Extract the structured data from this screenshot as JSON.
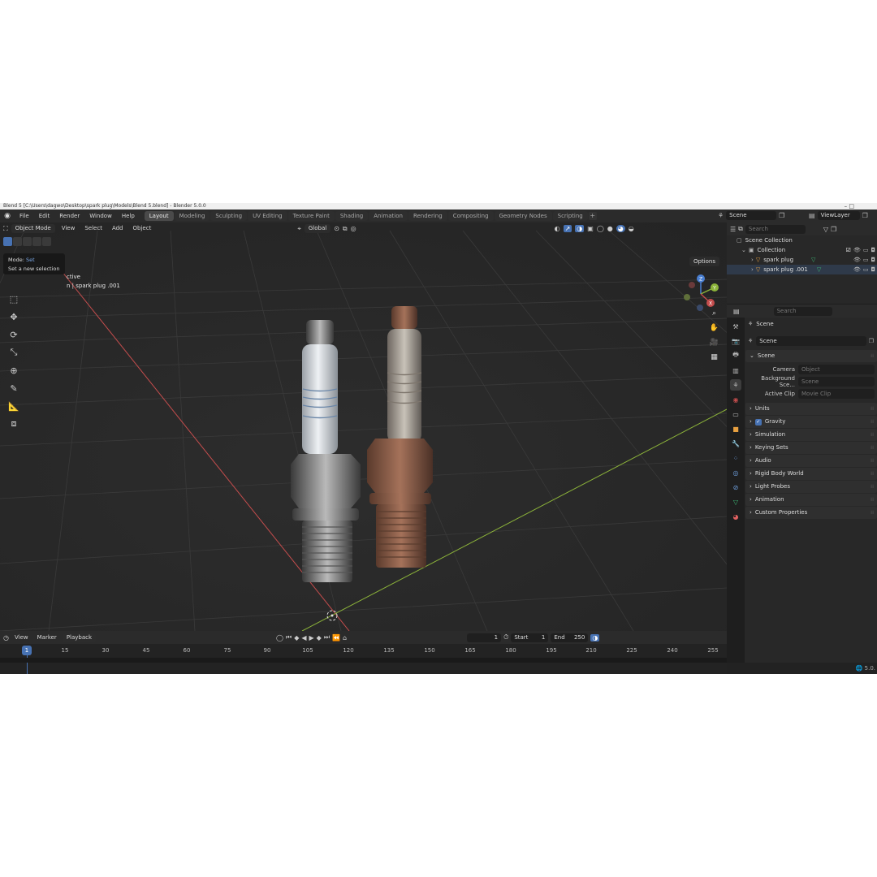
{
  "titlebar": {
    "text": "Blend 5 [C:\\Users\\dagwo\\Desktop\\spark plug\\Models\\Blend 5.blend] - Blender 5.0.0",
    "window_controls": "–  □"
  },
  "menubar": {
    "logo_icon": "blender-logo",
    "items": [
      "File",
      "Edit",
      "Render",
      "Window",
      "Help"
    ],
    "workspaces": [
      "Layout",
      "Modeling",
      "Sculpting",
      "UV Editing",
      "Texture Paint",
      "Shading",
      "Animation",
      "Rendering",
      "Compositing",
      "Geometry Nodes",
      "Scripting"
    ],
    "active_workspace": "Layout",
    "add_tab": "+",
    "scene": "Scene",
    "view_layer": "ViewLayer"
  },
  "viewport": {
    "mode": "Object Mode",
    "menus": [
      "View",
      "Select",
      "Add",
      "Object"
    ],
    "transform_orientation": "Global",
    "options_label": "Options",
    "tooltip": {
      "title_label": "Mode:",
      "title_value": "Set",
      "description": "Set a new selection"
    },
    "overlay": {
      "line1": "ctive",
      "line2": "n | spark plug .001"
    },
    "gizmo_axes": {
      "z": "Z",
      "y": "Y",
      "x": "X"
    }
  },
  "outliner": {
    "search_placeholder": "Search",
    "root": "Scene Collection",
    "collection": "Collection",
    "objects": [
      "spark plug",
      "spark plug .001"
    ]
  },
  "properties": {
    "search_placeholder": "Search",
    "context_label": "Scene",
    "scene_field": "Scene",
    "section": "Scene",
    "rows": [
      {
        "label": "Camera",
        "value": "Object"
      },
      {
        "label": "Background Sce...",
        "value": "Scene"
      },
      {
        "label": "Active Clip",
        "value": "Movie Clip"
      }
    ],
    "panels": [
      "Units",
      "Gravity",
      "Simulation",
      "Keying Sets",
      "Audio",
      "Rigid Body World",
      "Light Probes",
      "Animation",
      "Custom Properties"
    ]
  },
  "timeline": {
    "menus": [
      "View",
      "Marker",
      "Playback"
    ],
    "current_frame": "1",
    "start_label": "Start",
    "start_value": "1",
    "end_label": "End",
    "end_value": "250",
    "ruler_marker": "1",
    "ticks": [
      "15",
      "30",
      "45",
      "60",
      "75",
      "90",
      "105",
      "120",
      "135",
      "150",
      "165",
      "180",
      "195",
      "210",
      "225",
      "240",
      "255"
    ]
  },
  "status": {
    "version": "5.0."
  },
  "colors": {
    "accent": "#4772b3",
    "x_axis": "#c44d4d",
    "y_axis": "#8cb33a",
    "z_axis": "#4a7fd1"
  }
}
